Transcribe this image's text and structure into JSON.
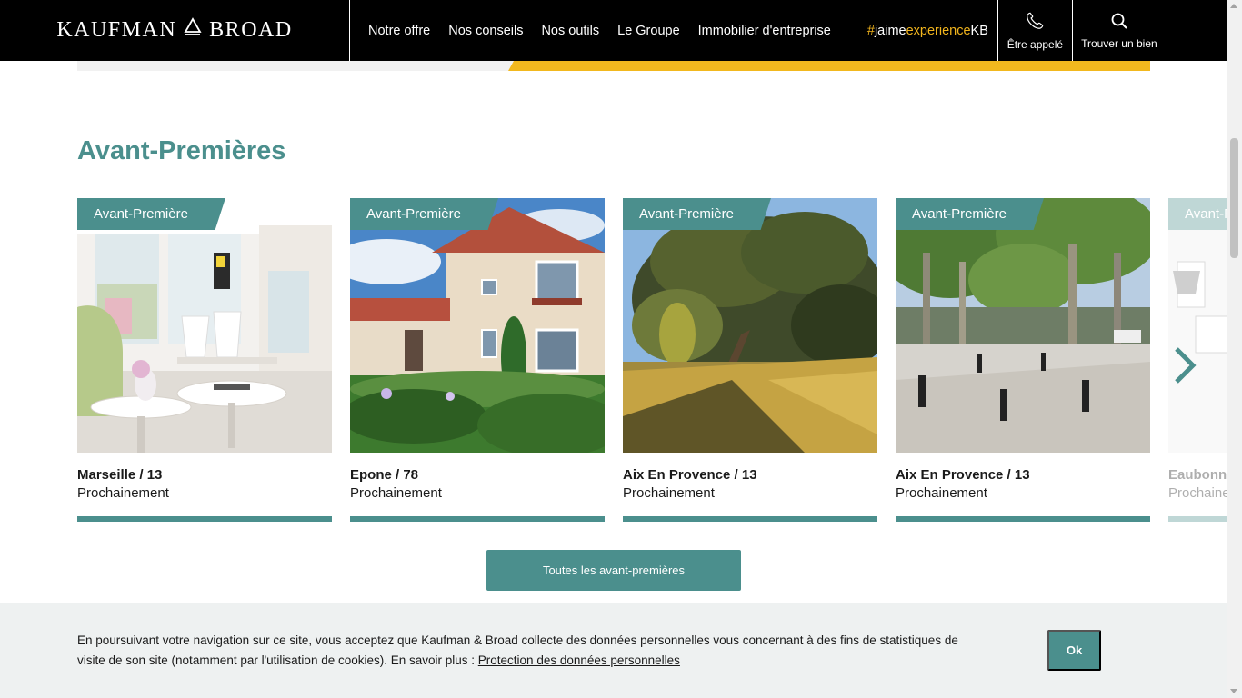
{
  "header": {
    "logo_left": "KAUFMAN",
    "logo_right": "BROAD",
    "nav": [
      "Notre offre",
      "Nos conseils",
      "Nos outils",
      "Le Groupe",
      "Immobilier d'entreprise"
    ],
    "hashtag": {
      "hash": "#",
      "jaime": "jaime",
      "experience": "experience",
      "kb": "KB"
    },
    "call_label": "Être appelé",
    "search_label": "Trouver un bien"
  },
  "section": {
    "title": "Avant-Premières"
  },
  "cards": [
    {
      "tag": "Avant-Première",
      "city": "Marseille / 13",
      "status": "Prochainement"
    },
    {
      "tag": "Avant-Première",
      "city": "Epone / 78",
      "status": "Prochainement"
    },
    {
      "tag": "Avant-Première",
      "city": "Aix En Provence / 13",
      "status": "Prochainement"
    },
    {
      "tag": "Avant-Première",
      "city": "Aix En Provence / 13",
      "status": "Prochainement"
    },
    {
      "tag": "Avant-Première",
      "city": "Eaubonne",
      "status": "Prochainement"
    }
  ],
  "all_button": "Toutes les avant-premières",
  "cookie": {
    "text": "En poursuivant votre navigation sur ce site, vous acceptez que Kaufman & Broad collecte des données personnelles vous concernant à des fins de statistiques de visite de son site (notamment par l'utilisation de cookies). En savoir plus : ",
    "link": "Protection des données personnelles",
    "ok": "Ok"
  },
  "colors": {
    "accent": "#4b8f8d",
    "yellow": "#f2b81e",
    "header_bg": "#000000"
  },
  "icons": [
    "phone-icon",
    "search-icon",
    "chevron-right-icon"
  ]
}
